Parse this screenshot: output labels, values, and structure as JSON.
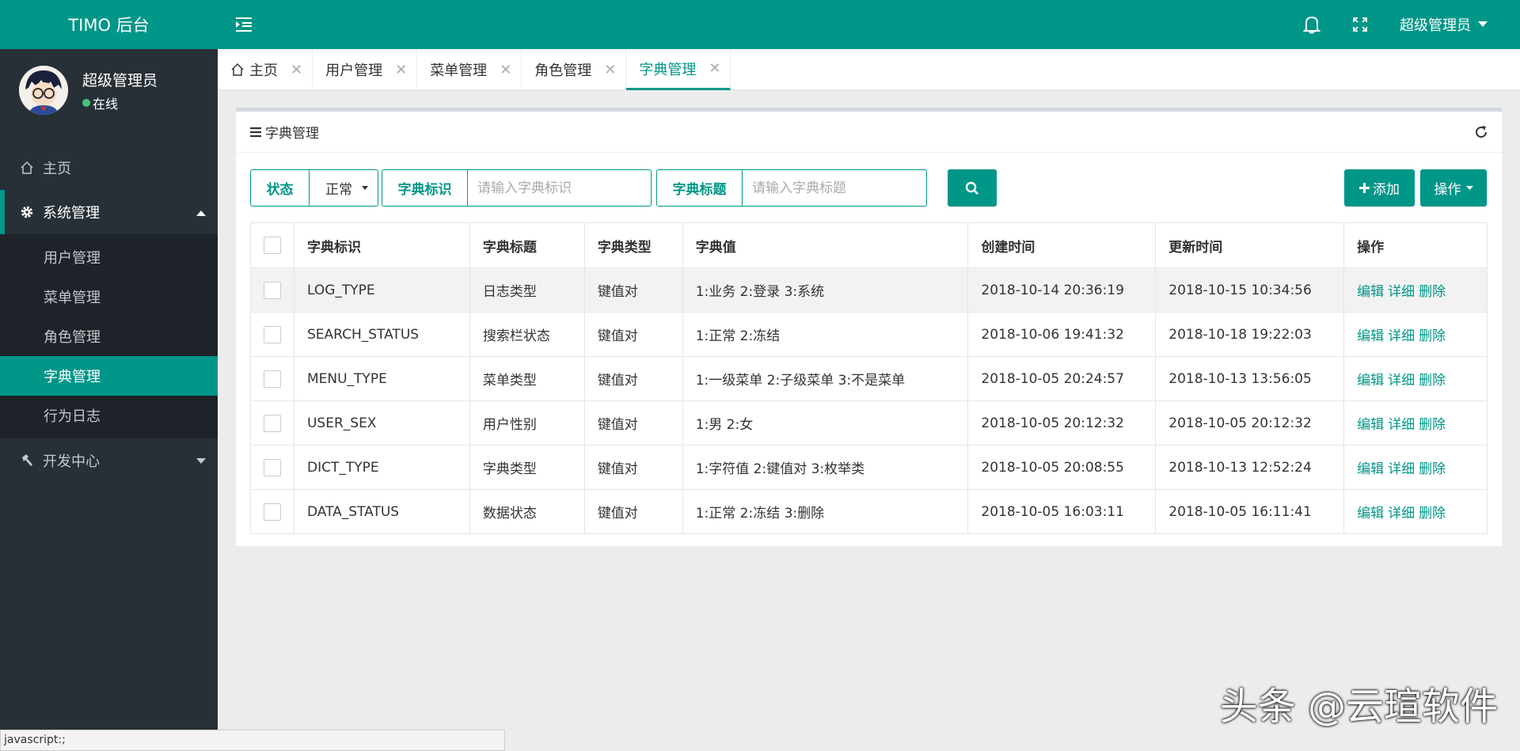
{
  "brand": "TIMO 后台",
  "user": {
    "name": "超级管理员",
    "status": "在线"
  },
  "sidebar": {
    "home": "主页",
    "system": "系统管理",
    "sub_items": [
      {
        "label": "用户管理"
      },
      {
        "label": "菜单管理"
      },
      {
        "label": "角色管理"
      },
      {
        "label": "字典管理"
      },
      {
        "label": "行为日志"
      }
    ],
    "dev_center": "开发中心"
  },
  "header": {
    "user_label": "超级管理员"
  },
  "tabs": [
    {
      "label": "主页"
    },
    {
      "label": "用户管理"
    },
    {
      "label": "菜单管理"
    },
    {
      "label": "角色管理"
    },
    {
      "label": "字典管理"
    }
  ],
  "panel": {
    "title": "字典管理"
  },
  "filters": {
    "status_label": "状态",
    "status_value": "正常",
    "name_label": "字典标识",
    "name_placeholder": "请输入字典标识",
    "title_label": "字典标题",
    "title_placeholder": "请输入字典标题"
  },
  "buttons": {
    "add": "添加",
    "ops": "操作"
  },
  "table": {
    "headers": [
      "字典标识",
      "字典标题",
      "字典类型",
      "字典值",
      "创建时间",
      "更新时间",
      "操作"
    ],
    "actions": [
      "编辑",
      "详细",
      "删除"
    ],
    "rows": [
      {
        "name": "LOG_TYPE",
        "title": "日志类型",
        "type": "键值对",
        "value": "1:业务 2:登录 3:系统",
        "created": "2018-10-14 20:36:19",
        "updated": "2018-10-15 10:34:56"
      },
      {
        "name": "SEARCH_STATUS",
        "title": "搜索栏状态",
        "type": "键值对",
        "value": "1:正常 2:冻结",
        "created": "2018-10-06 19:41:32",
        "updated": "2018-10-18 19:22:03"
      },
      {
        "name": "MENU_TYPE",
        "title": "菜单类型",
        "type": "键值对",
        "value": "1:一级菜单 2:子级菜单 3:不是菜单",
        "created": "2018-10-05 20:24:57",
        "updated": "2018-10-13 13:56:05"
      },
      {
        "name": "USER_SEX",
        "title": "用户性别",
        "type": "键值对",
        "value": "1:男 2:女",
        "created": "2018-10-05 20:12:32",
        "updated": "2018-10-05 20:12:32"
      },
      {
        "name": "DICT_TYPE",
        "title": "字典类型",
        "type": "键值对",
        "value": "1:字符值 2:键值对 3:枚举类",
        "created": "2018-10-05 20:08:55",
        "updated": "2018-10-13 12:52:24"
      },
      {
        "name": "DATA_STATUS",
        "title": "数据状态",
        "type": "键值对",
        "value": "1:正常 2:冻结 3:删除",
        "created": "2018-10-05 16:03:11",
        "updated": "2018-10-05 16:11:41"
      }
    ]
  },
  "statusbar": "javascript:;",
  "watermark": "头条 @云瑄软件",
  "colors": {
    "accent": "#009688",
    "sidebar_bg": "#283037",
    "submenu_bg": "#1d2328"
  },
  "icons": [
    "menu-fold-icon",
    "bell-icon",
    "fullscreen-icon",
    "caret-down-icon",
    "home-icon",
    "gear-icon",
    "caret-up-icon",
    "wrench-icon",
    "close-icon",
    "list-icon",
    "refresh-icon",
    "search-icon",
    "plus-icon"
  ]
}
